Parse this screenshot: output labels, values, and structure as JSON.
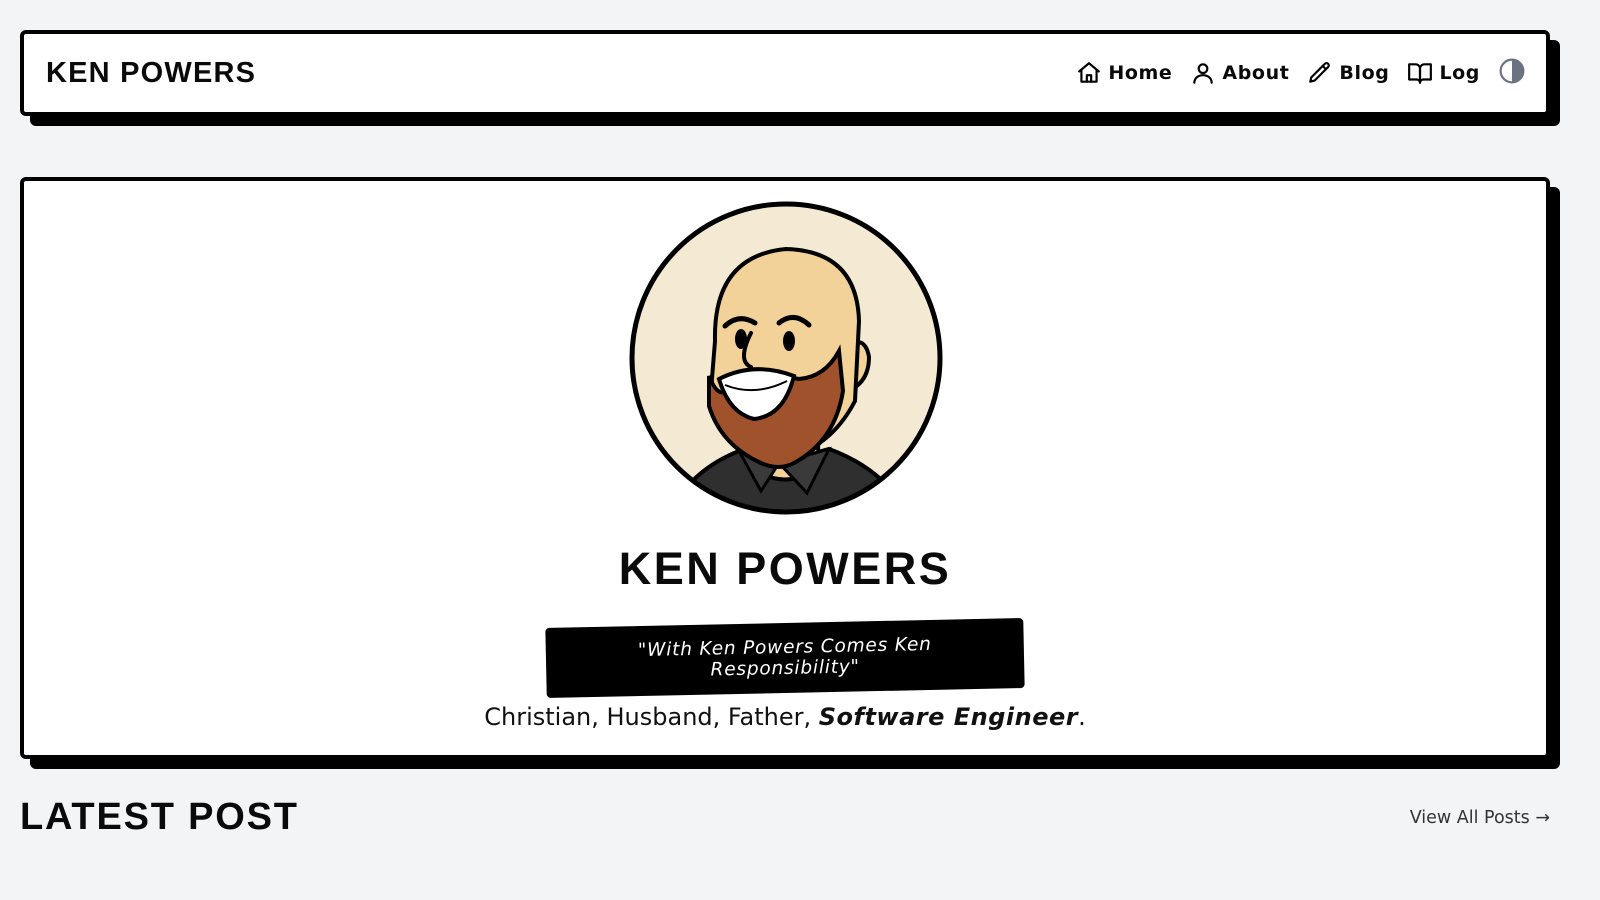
{
  "header": {
    "site_title": "KEN POWERS",
    "nav": [
      {
        "label": "Home",
        "icon": "home-icon"
      },
      {
        "label": "About",
        "icon": "user-icon"
      },
      {
        "label": "Blog",
        "icon": "pencil-icon"
      },
      {
        "label": "Log",
        "icon": "book-open-icon"
      }
    ],
    "theme_toggle_icon": "contrast-icon"
  },
  "hero": {
    "avatar_icon": "avatar-illustration",
    "name": "KEN POWERS",
    "tagline": "\"With Ken Powers Comes Ken Responsibility\"",
    "bio": {
      "prefix": "Christian, Husband, Father, ",
      "emphasis": "Software Engineer",
      "suffix": "."
    }
  },
  "latest": {
    "title": "LATEST POST",
    "view_all": "View All Posts →"
  },
  "colors": {
    "page_bg": "#f3f4f6",
    "card_bg": "#ffffff",
    "border": "#000000",
    "beard": "#a0522d",
    "skin": "#f2d299",
    "avatar_bg": "#f4ead3"
  }
}
